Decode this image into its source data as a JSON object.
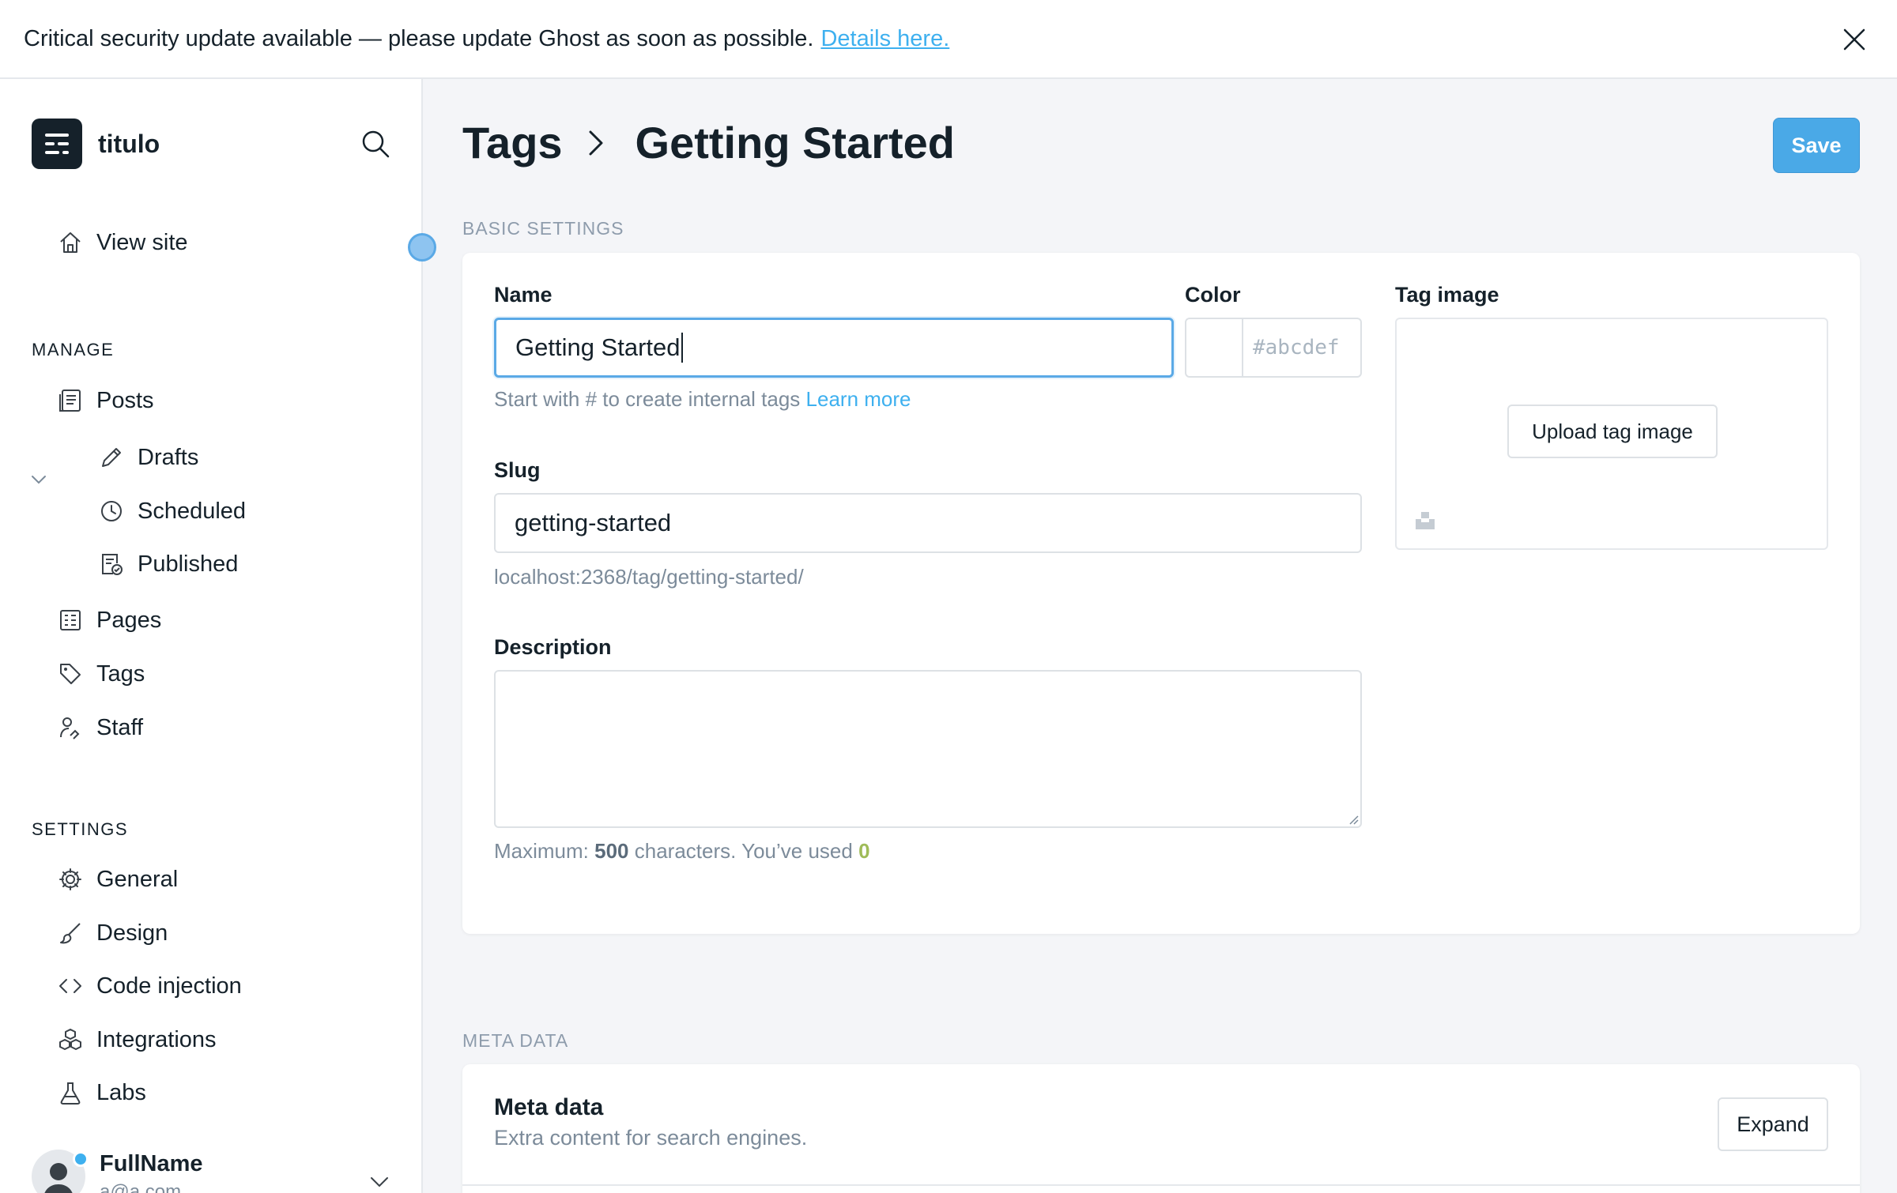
{
  "banner": {
    "message": "Critical security update available — please update Ghost as soon as possible.",
    "link_label": "Details here."
  },
  "sidebar": {
    "brand_name": "titulo",
    "view_site": "View site",
    "manage_label": "MANAGE",
    "posts": "Posts",
    "drafts": "Drafts",
    "scheduled": "Scheduled",
    "published": "Published",
    "pages": "Pages",
    "tags": "Tags",
    "staff": "Staff",
    "settings_label": "SETTINGS",
    "general": "General",
    "design": "Design",
    "code_injection": "Code injection",
    "integrations": "Integrations",
    "labs": "Labs",
    "user_name": "FullName",
    "user_email": "a@a.com"
  },
  "header": {
    "crumb_parent": "Tags",
    "crumb_current": "Getting Started",
    "save_label": "Save"
  },
  "basic": {
    "section_label": "BASIC SETTINGS",
    "name_label": "Name",
    "name_value": "Getting Started",
    "name_hint": "Start with # to create internal tags",
    "learn_more": "Learn more",
    "color_label": "Color",
    "color_placeholder": "#abcdef",
    "tag_image_label": "Tag image",
    "upload_label": "Upload tag image",
    "slug_label": "Slug",
    "slug_value": "getting-started",
    "slug_url": "localhost:2368/tag/getting-started/",
    "description_label": "Description",
    "max_prefix": "Maximum:",
    "max_value": "500",
    "max_middle": "characters. You’ve used",
    "used_value": "0"
  },
  "meta": {
    "section_label": "META DATA",
    "title": "Meta data",
    "description": "Extra content for search engines.",
    "expand_label": "Expand"
  },
  "colors": {
    "accent": "#3eb0ef",
    "save_button": "#4aa9e7",
    "counter_green": "#9fbb58"
  }
}
